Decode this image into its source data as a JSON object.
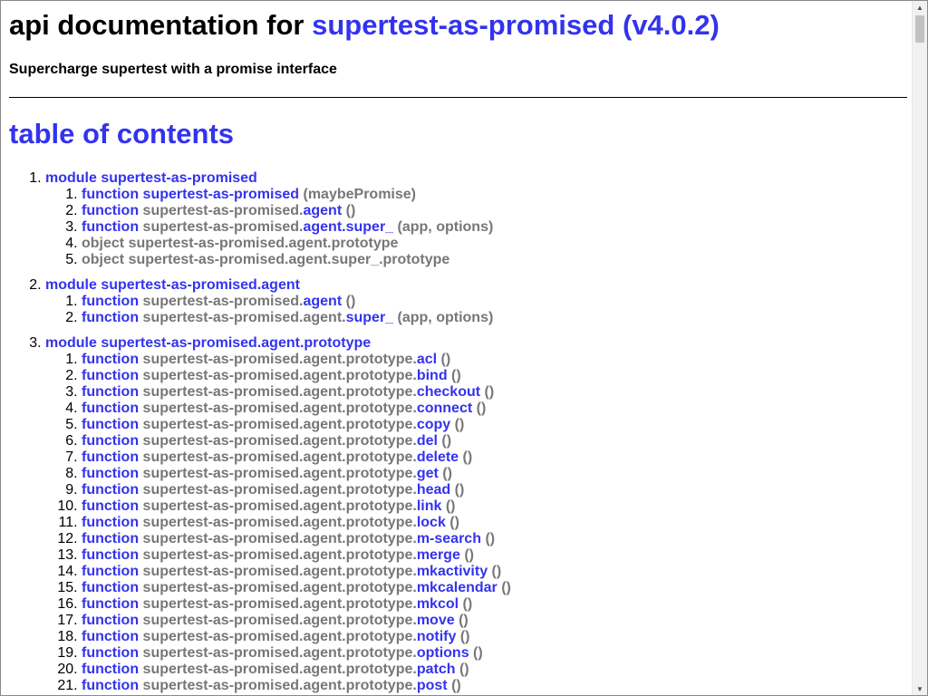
{
  "header": {
    "title_prefix": "api documentation for",
    "title_link": "supertest-as-promised (v4.0.2)",
    "subtitle": "Supercharge supertest with a promise interface"
  },
  "toc": {
    "heading": "table of contents",
    "modules": [
      {
        "label": "module supertest-as-promised",
        "items": [
          {
            "kind": "function",
            "prefix": "",
            "name": "supertest-as-promised",
            "args": "(maybePromise)"
          },
          {
            "kind": "function",
            "prefix": "supertest-as-promised.",
            "name": "agent",
            "args": "()"
          },
          {
            "kind": "function",
            "prefix": "supertest-as-promised.",
            "name": "agent.super_",
            "args": "(app, options)"
          },
          {
            "kind": "object",
            "text": "object supertest-as-promised.agent.prototype"
          },
          {
            "kind": "object",
            "text": "object supertest-as-promised.agent.super_.prototype"
          }
        ]
      },
      {
        "label": "module supertest-as-promised.agent",
        "items": [
          {
            "kind": "function",
            "prefix": "supertest-as-promised.",
            "name": "agent",
            "args": "()"
          },
          {
            "kind": "function",
            "prefix": "supertest-as-promised.agent.",
            "name": "super_",
            "args": "(app, options)"
          }
        ]
      },
      {
        "label": "module supertest-as-promised.agent.prototype",
        "items": [
          {
            "kind": "function",
            "prefix": "supertest-as-promised.agent.prototype.",
            "name": "acl",
            "args": "()"
          },
          {
            "kind": "function",
            "prefix": "supertest-as-promised.agent.prototype.",
            "name": "bind",
            "args": "()"
          },
          {
            "kind": "function",
            "prefix": "supertest-as-promised.agent.prototype.",
            "name": "checkout",
            "args": "()"
          },
          {
            "kind": "function",
            "prefix": "supertest-as-promised.agent.prototype.",
            "name": "connect",
            "args": "()"
          },
          {
            "kind": "function",
            "prefix": "supertest-as-promised.agent.prototype.",
            "name": "copy",
            "args": "()"
          },
          {
            "kind": "function",
            "prefix": "supertest-as-promised.agent.prototype.",
            "name": "del",
            "args": "()"
          },
          {
            "kind": "function",
            "prefix": "supertest-as-promised.agent.prototype.",
            "name": "delete",
            "args": "()"
          },
          {
            "kind": "function",
            "prefix": "supertest-as-promised.agent.prototype.",
            "name": "get",
            "args": "()"
          },
          {
            "kind": "function",
            "prefix": "supertest-as-promised.agent.prototype.",
            "name": "head",
            "args": "()"
          },
          {
            "kind": "function",
            "prefix": "supertest-as-promised.agent.prototype.",
            "name": "link",
            "args": "()"
          },
          {
            "kind": "function",
            "prefix": "supertest-as-promised.agent.prototype.",
            "name": "lock",
            "args": "()"
          },
          {
            "kind": "function",
            "prefix": "supertest-as-promised.agent.prototype.",
            "name": "m-search",
            "args": "()"
          },
          {
            "kind": "function",
            "prefix": "supertest-as-promised.agent.prototype.",
            "name": "merge",
            "args": "()"
          },
          {
            "kind": "function",
            "prefix": "supertest-as-promised.agent.prototype.",
            "name": "mkactivity",
            "args": "()"
          },
          {
            "kind": "function",
            "prefix": "supertest-as-promised.agent.prototype.",
            "name": "mkcalendar",
            "args": "()"
          },
          {
            "kind": "function",
            "prefix": "supertest-as-promised.agent.prototype.",
            "name": "mkcol",
            "args": "()"
          },
          {
            "kind": "function",
            "prefix": "supertest-as-promised.agent.prototype.",
            "name": "move",
            "args": "()"
          },
          {
            "kind": "function",
            "prefix": "supertest-as-promised.agent.prototype.",
            "name": "notify",
            "args": "()"
          },
          {
            "kind": "function",
            "prefix": "supertest-as-promised.agent.prototype.",
            "name": "options",
            "args": "()"
          },
          {
            "kind": "function",
            "prefix": "supertest-as-promised.agent.prototype.",
            "name": "patch",
            "args": "()"
          },
          {
            "kind": "function",
            "prefix": "supertest-as-promised.agent.prototype.",
            "name": "post",
            "args": "()"
          }
        ]
      }
    ]
  },
  "icons": {
    "scroll_up": "scroll-up-arrow-icon",
    "scroll_down": "scroll-down-arrow-icon"
  },
  "colors": {
    "link": "#3333ee",
    "muted": "#777777"
  }
}
